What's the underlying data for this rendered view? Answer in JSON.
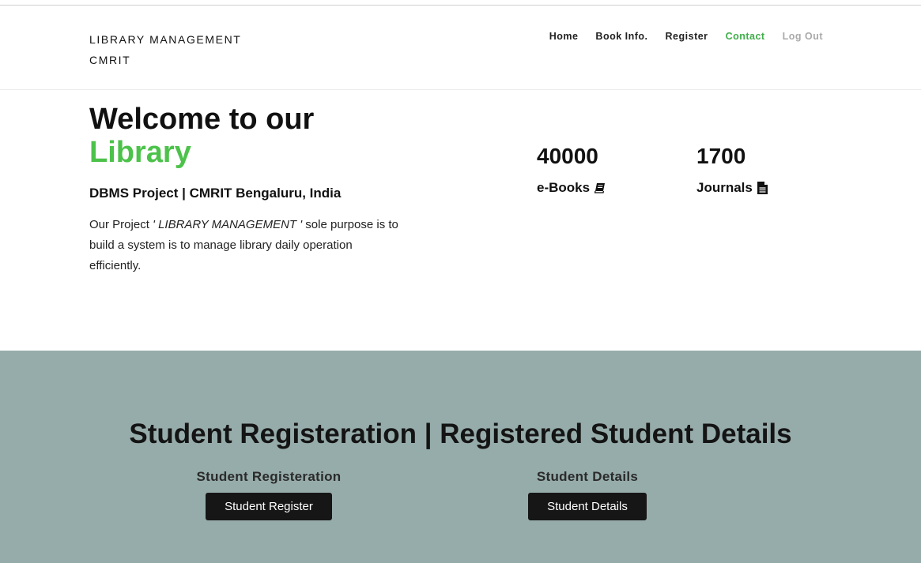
{
  "header": {
    "brand_line1": "LIBRARY MANAGEMENT",
    "brand_line2": "CMRIT",
    "nav": {
      "home": "Home",
      "book_info": "Book Info.",
      "register": "Register",
      "contact": "Contact",
      "logout": "Log Out"
    }
  },
  "hero": {
    "title_line1": "Welcome to our",
    "title_line2": "Library",
    "subtitle": "DBMS Project | CMRIT Bengaluru, India",
    "desc_prefix": "Our Project ",
    "desc_em": "' LIBRARY MANAGEMENT '",
    "desc_suffix": " sole purpose is to build a system is to manage library daily operation efficiently."
  },
  "stats": {
    "ebooks_value": "40000",
    "ebooks_label": "e-Books",
    "journals_value": "1700",
    "journals_label": "Journals"
  },
  "students": {
    "section_title": "Student Registeration | Registered Student Details",
    "register_heading": "Student Registeration",
    "register_button": "Student Register",
    "details_heading": "Student Details",
    "details_button": "Student Details"
  },
  "colors": {
    "accent_green": "#4cc24a",
    "contact_green": "#3fae4a",
    "band_background": "#96acaa",
    "button_dark": "#161616"
  },
  "icons": {
    "ebooks": "book-icon",
    "journals": "file-text-icon"
  }
}
